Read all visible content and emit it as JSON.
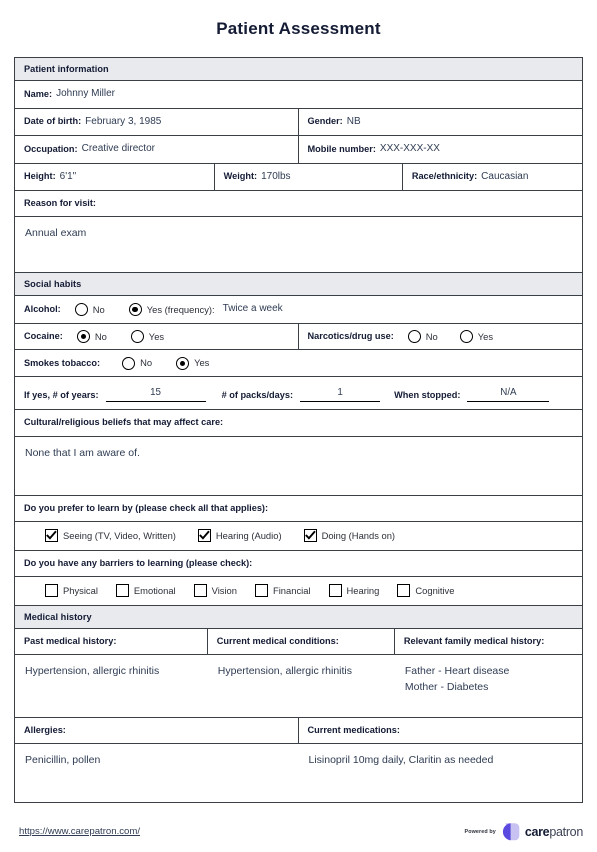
{
  "document": {
    "title": "Patient Assessment"
  },
  "patient_information": {
    "section_title": "Patient information",
    "name_label": "Name:",
    "name_value": "Johnny Miller",
    "dob_label": "Date of birth:",
    "dob_value": "February 3, 1985",
    "gender_label": "Gender:",
    "gender_value": "NB",
    "occupation_label": "Occupation:",
    "occupation_value": "Creative director",
    "mobile_label": "Mobile number:",
    "mobile_value": "XXX-XXX-XX",
    "height_label": "Height:",
    "height_value": "6'1\"",
    "weight_label": "Weight:",
    "weight_value": "170lbs",
    "race_label": "Race/ethnicity:",
    "race_value": "Caucasian",
    "reason_label": "Reason for visit:",
    "reason_value": "Annual exam"
  },
  "social_habits": {
    "section_title": "Social habits",
    "alcohol": {
      "label": "Alcohol:",
      "no_label": "No",
      "no_selected": false,
      "yes_label": "Yes (frequency):",
      "yes_selected": true,
      "frequency_value": "Twice a week"
    },
    "cocaine": {
      "label": "Cocaine:",
      "no_label": "No",
      "no_selected": true,
      "yes_label": "Yes",
      "yes_selected": false
    },
    "narcotics": {
      "label": "Narcotics/drug use:",
      "no_label": "No",
      "no_selected": false,
      "yes_label": "Yes",
      "yes_selected": false
    },
    "tobacco": {
      "label": "Smokes tobacco:",
      "no_label": "No",
      "no_selected": false,
      "yes_label": "Yes",
      "yes_selected": true
    },
    "years_label": "If yes, # of years:",
    "years_value": "15",
    "packs_label": "# of packs/days:",
    "packs_value": "1",
    "stopped_label": "When stopped:",
    "stopped_value": "N/A"
  },
  "beliefs": {
    "label": "Cultural/religious beliefs that may affect care:",
    "value": "None that I am aware of."
  },
  "learning": {
    "prefer_label": "Do you prefer to learn by (please check all that applies):",
    "options": [
      {
        "label": "Seeing (TV, Video, Written)",
        "checked": true
      },
      {
        "label": "Hearing (Audio)",
        "checked": true
      },
      {
        "label": "Doing (Hands on)",
        "checked": true
      }
    ],
    "barriers_label": "Do you have any barriers to learning (please check):",
    "barriers": [
      {
        "label": "Physical",
        "checked": false
      },
      {
        "label": "Emotional",
        "checked": false
      },
      {
        "label": "Vision",
        "checked": false
      },
      {
        "label": "Financial",
        "checked": false
      },
      {
        "label": "Hearing",
        "checked": false
      },
      {
        "label": "Cognitive",
        "checked": false
      }
    ]
  },
  "medical_history": {
    "section_title": "Medical history",
    "columns": [
      "Past medical history:",
      "Current medical conditions:",
      "Relevant family medical history:"
    ],
    "values": [
      "Hypertension, allergic rhinitis",
      "Hypertension, allergic rhinitis",
      "Father - Heart disease\nMother - Diabetes"
    ],
    "allergies_label": "Allergies:",
    "allergies_value": "Penicillin, pollen",
    "medications_label": "Current medications:",
    "medications_value": "Lisinopril 10mg daily, Claritin as needed"
  },
  "footer": {
    "url": "https://www.carepatron.com/",
    "powered_by": "Powered by",
    "brand_bold": "care",
    "brand_light": "patron",
    "logo_color_dark": "#5b4ae0",
    "logo_color_light": "#c8c2f2"
  }
}
